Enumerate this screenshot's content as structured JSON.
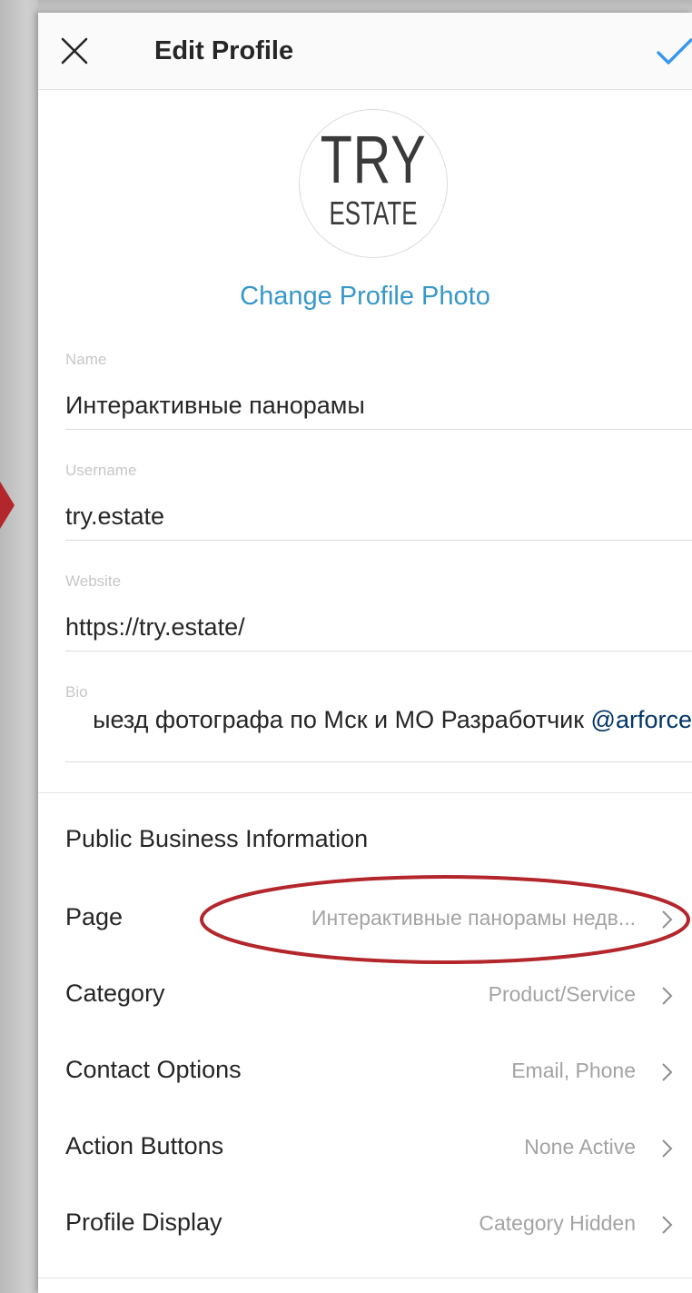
{
  "header": {
    "title": "Edit Profile"
  },
  "avatar": {
    "line1": "TRY",
    "line2": "ESTATE"
  },
  "change_photo_label": "Change Profile Photo",
  "fields": {
    "name": {
      "label": "Name",
      "value": "Интерактивные панорамы"
    },
    "username": {
      "label": "Username",
      "value": "try.estate"
    },
    "website": {
      "label": "Website",
      "value": "https://try.estate/"
    },
    "bio": {
      "label": "Bio",
      "value": "ыезд фотографа по Мск и МО Разработчик ",
      "mention": "@arforce"
    }
  },
  "business": {
    "section_title": "Public Business Information",
    "rows": [
      {
        "label": "Page",
        "value": "Интерактивные панорамы недв..."
      },
      {
        "label": "Category",
        "value": "Product/Service"
      },
      {
        "label": "Contact Options",
        "value": "Email, Phone"
      },
      {
        "label": "Action Buttons",
        "value": "None Active"
      },
      {
        "label": "Profile Display",
        "value": "Category Hidden"
      }
    ]
  },
  "colors": {
    "link_blue": "#3897c8",
    "annotation_red": "#b3262b",
    "mention": "#003569"
  },
  "icons": {
    "close": "close-icon",
    "check": "check-icon",
    "chevron": "chevron-right-icon"
  }
}
